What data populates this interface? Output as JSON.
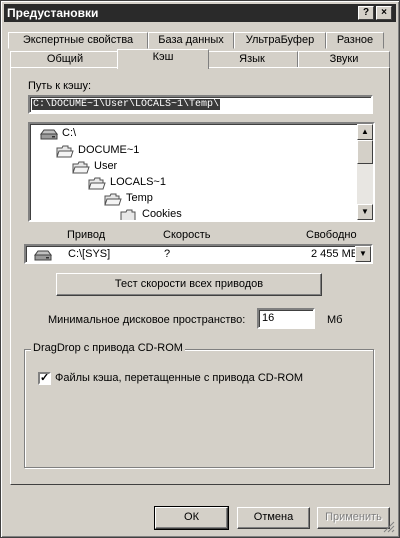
{
  "window": {
    "title": "Предустановки",
    "help_glyph": "?",
    "close_glyph": "×"
  },
  "tabs": {
    "row_back": [
      "Экспертные свойства",
      "База данных",
      "УльтраБуфер",
      "Разное"
    ],
    "row_front": [
      "Общий",
      "Кэш",
      "Язык",
      "Звуки"
    ],
    "active": "Кэш"
  },
  "cache": {
    "path_label": "Путь к кэшу:",
    "path_value": "C:\\DOCUME~1\\User\\LOCALS~1\\Temp\\",
    "tree": [
      {
        "label": "C:\\",
        "icon": "drive-icon"
      },
      {
        "label": "DOCUME~1",
        "icon": "folder-open-icon"
      },
      {
        "label": "User",
        "icon": "folder-open-icon"
      },
      {
        "label": "LOCALS~1",
        "icon": "folder-open-icon"
      },
      {
        "label": "Temp",
        "icon": "folder-open-icon"
      },
      {
        "label": "Cookies",
        "icon": "folder-icon"
      }
    ],
    "drive_headers": {
      "drive": "Привод",
      "speed": "Скорость",
      "free": "Свободно"
    },
    "drive_row": {
      "drive": "C:\\[SYS]",
      "speed": "?",
      "free": "2 455 МВ"
    },
    "speed_test_button": "Тест скорости всех приводов",
    "min_space_label": "Минимальное дисковое пространство:",
    "min_space_value": "16",
    "min_space_unit": "Мб",
    "dragdrop_group": "DragDrop с привода CD-ROM",
    "dragdrop_checkbox": "Файлы кэша, перетащенные с привода CD-ROM",
    "dragdrop_checked": true
  },
  "footer": {
    "ok": "ОК",
    "cancel": "Отмена",
    "apply": "Применить"
  }
}
